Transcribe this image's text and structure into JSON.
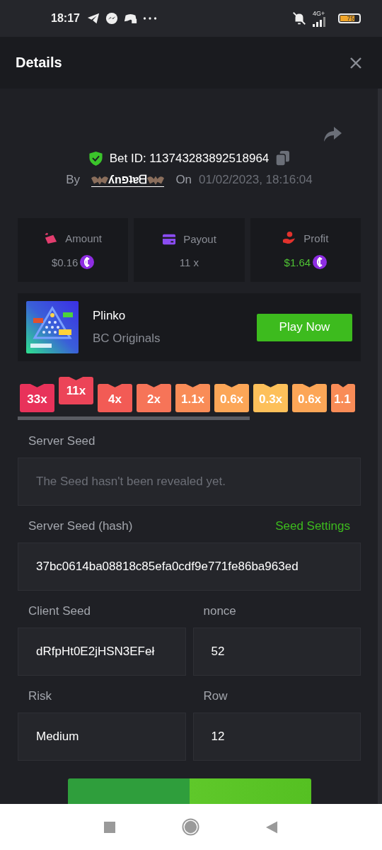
{
  "status_bar": {
    "time": "18:17",
    "network": "4G+",
    "battery": "75"
  },
  "header": {
    "title": "Details"
  },
  "bet": {
    "id_label": "Bet ID: 113743283892518964",
    "by_label": "By",
    "user": "ʎnפʇɐᗺ",
    "on_label": "On",
    "date": "01/02/2023, 18:16:04"
  },
  "stats": [
    {
      "kind": "amount",
      "label": "Amount",
      "value": "$0.16",
      "coin": true
    },
    {
      "kind": "payout",
      "label": "Payout",
      "value": "11 x",
      "coin": false
    },
    {
      "kind": "profit",
      "label": "Profit",
      "value": "$1.64",
      "coin": true
    }
  ],
  "game": {
    "name": "Plinko",
    "provider": "BC Originals",
    "button": "Play Now"
  },
  "multipliers": [
    {
      "label": "33x",
      "color": "#e8325a",
      "selected": false
    },
    {
      "label": "11x",
      "color": "#ec4458",
      "selected": true
    },
    {
      "label": "4x",
      "color": "#f25b55",
      "selected": false
    },
    {
      "label": "2x",
      "color": "#f67458",
      "selected": false
    },
    {
      "label": "1.1x",
      "color": "#f98c57",
      "selected": false
    },
    {
      "label": "0.6x",
      "color": "#fca657",
      "selected": false
    },
    {
      "label": "0.3x",
      "color": "#fdc05a",
      "selected": false
    },
    {
      "label": "0.6x",
      "color": "#fca657",
      "selected": false
    },
    {
      "label": "1.1",
      "color": "#f98c57",
      "selected": false
    }
  ],
  "server_seed": {
    "label": "Server Seed",
    "placeholder": "The Seed hasn't been revealed yet."
  },
  "server_hash": {
    "label": "Server Seed (hash)",
    "link": "Seed Settings",
    "value": "37bc0614ba08818c85efa0cdf9e771fe86ba963ed"
  },
  "pairs": [
    [
      {
        "label": "Client Seed",
        "value": "dRfpHt0E2jHSN3EFeł"
      },
      {
        "label": "nonce",
        "value": "52"
      }
    ],
    [
      {
        "label": "Risk",
        "value": "Medium"
      },
      {
        "label": "Row",
        "value": "12"
      }
    ]
  ]
}
